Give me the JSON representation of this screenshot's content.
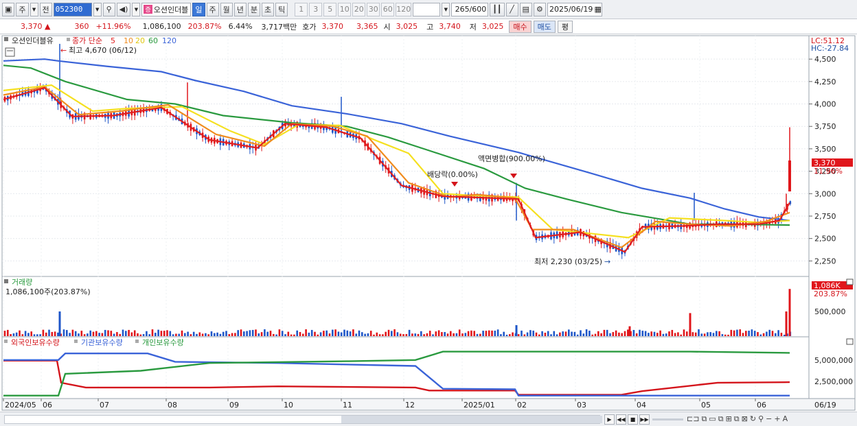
{
  "toolbar": {
    "period_day": "주",
    "prev_label": "전",
    "stock_code": "052300",
    "stock_name": "오션인더블",
    "stock_tag": "증",
    "period_tabs": [
      "일",
      "주",
      "월",
      "년",
      "분",
      "초",
      "틱"
    ],
    "selected_tab": "일",
    "minute_options": [
      "1",
      "3",
      "5",
      "10",
      "20",
      "30",
      "60",
      "120"
    ],
    "count": "265",
    "count_max": "/600",
    "date": "2025/06/19"
  },
  "quote": {
    "price": "3,370",
    "change": "360",
    "change_pct": "+11.96%",
    "volume": "1,086,100",
    "volume_ratio": "203.87%",
    "turnover_rate": "6.44%",
    "trade_value": "3,717백만",
    "ask_label": "호가",
    "ask_value": "3,370",
    "bid_value": "3,365",
    "open_label": "시",
    "open_value": "3,025",
    "high_label": "고",
    "high_value": "3,740",
    "low_label": "저",
    "low_value": "3,025",
    "buy_label": "매수",
    "sell_label": "매도",
    "avg_label": "평"
  },
  "price_panel": {
    "name": "오션인더블유",
    "legend_prefix": "종가 단순",
    "ma_periods": [
      "5",
      "10",
      "20",
      "60",
      "120"
    ],
    "ma_colors": [
      "#e02020",
      "#f08c1e",
      "#f5e020",
      "#2a9a3f",
      "#3a63d8"
    ],
    "lc_label": "LC:51.12",
    "hc_label": "HC:-27.84",
    "last_price_label": "3,370",
    "last_pct_label": "11.96%",
    "high_note": "최고 4,670 (06/12)",
    "low_note": "최저 2,230 (03/25)",
    "event_dividend": "배당락(0.00%)",
    "event_consolidation": "액면병합(900.00%)",
    "y_ticks": [
      "4,500",
      "4,250",
      "4,000",
      "3,750",
      "3,500",
      "3,250",
      "3,000",
      "2,750",
      "2,500",
      "2,250"
    ]
  },
  "volume_panel": {
    "title": "거래량",
    "value_label": "1,086,100주(203.87%)",
    "y_tick": "500,000",
    "last_label": "1,086K",
    "last_pct": "203.87%"
  },
  "holding_panel": {
    "legend": [
      "외국인보유수량",
      "기관보유수량",
      "개인보유수량"
    ],
    "legend_colors": [
      "#d4141b",
      "#3a63d8",
      "#2a9a3f"
    ],
    "y_ticks": [
      "5,000,000",
      "2,500,000"
    ]
  },
  "x_axis": {
    "labels": [
      "2024/05",
      "06",
      "07",
      "08",
      "09",
      "10",
      "11",
      "12",
      "2025/01",
      "02",
      "03",
      "04",
      "05",
      "06"
    ],
    "end_label": "06/19"
  },
  "chart_data": {
    "type": "candlestick",
    "y_range": [
      2100,
      4700
    ],
    "ma120": [
      [
        0,
        4480
      ],
      [
        60,
        4500
      ],
      [
        80,
        4480
      ],
      [
        150,
        4420
      ],
      [
        230,
        4360
      ],
      [
        280,
        4260
      ],
      [
        350,
        4140
      ],
      [
        420,
        3980
      ],
      [
        500,
        3890
      ],
      [
        580,
        3780
      ],
      [
        650,
        3640
      ],
      [
        750,
        3460
      ],
      [
        850,
        3240
      ],
      [
        930,
        3060
      ],
      [
        1000,
        2950
      ],
      [
        1050,
        2830
      ],
      [
        1100,
        2740
      ],
      [
        1145,
        2700
      ]
    ],
    "ma60": [
      [
        0,
        4430
      ],
      [
        40,
        4400
      ],
      [
        90,
        4250
      ],
      [
        180,
        4050
      ],
      [
        250,
        4000
      ],
      [
        320,
        3870
      ],
      [
        420,
        3790
      ],
      [
        500,
        3750
      ],
      [
        560,
        3630
      ],
      [
        620,
        3480
      ],
      [
        700,
        3280
      ],
      [
        760,
        3060
      ],
      [
        820,
        2940
      ],
      [
        900,
        2790
      ],
      [
        1000,
        2660
      ],
      [
        1060,
        2660
      ],
      [
        1145,
        2650
      ]
    ],
    "ma20": [
      [
        0,
        4150
      ],
      [
        70,
        4210
      ],
      [
        130,
        3920
      ],
      [
        180,
        3950
      ],
      [
        260,
        3970
      ],
      [
        330,
        3700
      ],
      [
        380,
        3550
      ],
      [
        430,
        3770
      ],
      [
        490,
        3760
      ],
      [
        540,
        3600
      ],
      [
        590,
        3450
      ],
      [
        640,
        3000
      ],
      [
        680,
        2980
      ],
      [
        750,
        2960
      ],
      [
        800,
        2600
      ],
      [
        850,
        2560
      ],
      [
        910,
        2510
      ],
      [
        970,
        2730
      ],
      [
        1050,
        2700
      ],
      [
        1100,
        2680
      ],
      [
        1145,
        2700
      ]
    ],
    "ma10": [
      [
        0,
        4100
      ],
      [
        60,
        4190
      ],
      [
        110,
        3880
      ],
      [
        170,
        3920
      ],
      [
        240,
        3990
      ],
      [
        310,
        3660
      ],
      [
        380,
        3530
      ],
      [
        420,
        3780
      ],
      [
        480,
        3750
      ],
      [
        530,
        3640
      ],
      [
        590,
        3120
      ],
      [
        650,
        2960
      ],
      [
        690,
        2990
      ],
      [
        745,
        2950
      ],
      [
        770,
        2600
      ],
      [
        830,
        2600
      ],
      [
        900,
        2400
      ],
      [
        950,
        2690
      ],
      [
        1000,
        2660
      ],
      [
        1060,
        2640
      ],
      [
        1110,
        2690
      ],
      [
        1145,
        2790
      ]
    ],
    "ma5": [
      [
        0,
        4050
      ],
      [
        60,
        4180
      ],
      [
        100,
        3860
      ],
      [
        160,
        3870
      ],
      [
        230,
        3960
      ],
      [
        300,
        3600
      ],
      [
        370,
        3510
      ],
      [
        410,
        3780
      ],
      [
        470,
        3740
      ],
      [
        520,
        3620
      ],
      [
        580,
        3090
      ],
      [
        640,
        2970
      ],
      [
        680,
        2960
      ],
      [
        750,
        2940
      ],
      [
        775,
        2510
      ],
      [
        840,
        2570
      ],
      [
        905,
        2350
      ],
      [
        930,
        2630
      ],
      [
        990,
        2640
      ],
      [
        1040,
        2660
      ],
      [
        1100,
        2660
      ],
      [
        1130,
        2700
      ],
      [
        1145,
        2900
      ]
    ],
    "volume_spikes": [
      [
        82,
        0.45
      ],
      [
        747,
        0.2
      ],
      [
        912,
        0.18
      ],
      [
        1000,
        0.42
      ],
      [
        1140,
        0.45
      ],
      [
        1145,
        0.86
      ]
    ],
    "foreign_holding": [
      [
        0,
        6000000
      ],
      [
        78,
        6000000
      ],
      [
        84,
        2300000
      ],
      [
        120,
        1500000
      ],
      [
        300,
        1500000
      ],
      [
        400,
        1700000
      ],
      [
        600,
        1500000
      ],
      [
        620,
        1000000
      ],
      [
        745,
        1000000
      ],
      [
        750,
        300000
      ],
      [
        900,
        300000
      ],
      [
        930,
        900000
      ],
      [
        1040,
        2300000
      ],
      [
        1145,
        2400000
      ]
    ],
    "institution_holding": [
      [
        0,
        6100000
      ],
      [
        80,
        6100000
      ],
      [
        90,
        7200000
      ],
      [
        210,
        7200000
      ],
      [
        250,
        5800000
      ],
      [
        400,
        5600000
      ],
      [
        600,
        5100000
      ],
      [
        640,
        1300000
      ],
      [
        745,
        1200000
      ],
      [
        750,
        150000
      ],
      [
        1000,
        150000
      ],
      [
        1145,
        150000
      ]
    ],
    "individual_holding": [
      [
        0,
        150000
      ],
      [
        80,
        150000
      ],
      [
        90,
        3800000
      ],
      [
        200,
        4300000
      ],
      [
        300,
        5600000
      ],
      [
        500,
        5900000
      ],
      [
        600,
        6100000
      ],
      [
        640,
        7500000
      ],
      [
        1000,
        7500000
      ],
      [
        1145,
        7300000
      ]
    ]
  }
}
